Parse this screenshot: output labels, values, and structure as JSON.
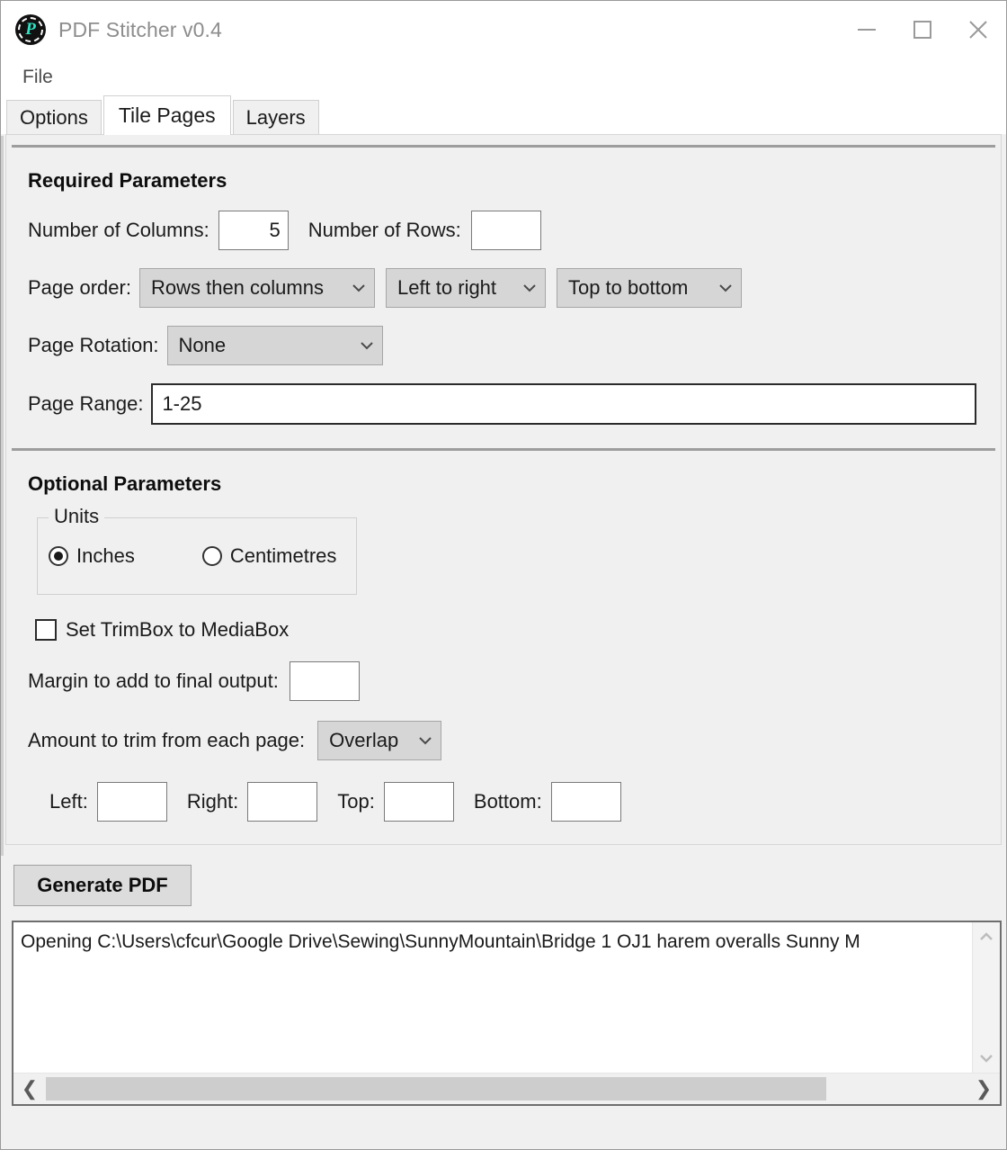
{
  "window": {
    "title": "PDF Stitcher v0.4",
    "icon": "pdf-stitcher-logo",
    "controls": {
      "minimize": "minimize-icon",
      "maximize": "maximize-icon",
      "close": "close-icon"
    }
  },
  "menubar": {
    "items": [
      {
        "label": "File"
      }
    ]
  },
  "tabs": [
    {
      "label": "Options",
      "selected": false
    },
    {
      "label": "Tile Pages",
      "selected": true
    },
    {
      "label": "Layers",
      "selected": false
    }
  ],
  "required": {
    "heading": "Required Parameters",
    "columns_label": "Number of Columns:",
    "columns_value": "5",
    "rows_label": "Number of Rows:",
    "rows_value": "",
    "page_order_label": "Page order:",
    "page_order_value": "Rows then columns",
    "horizontal_order_value": "Left to right",
    "vertical_order_value": "Top to bottom",
    "rotation_label": "Page Rotation:",
    "rotation_value": "None",
    "page_range_label": "Page Range:",
    "page_range_value": "1-25"
  },
  "optional": {
    "heading": "Optional Parameters",
    "units_group_label": "Units",
    "unit_inches": "Inches",
    "unit_centimetres": "Centimetres",
    "units_selected": "Inches",
    "trimbox_label": "Set TrimBox to MediaBox",
    "trimbox_checked": false,
    "margin_label": "Margin to add to final output:",
    "margin_value": "",
    "trim_label": "Amount to trim from each page:",
    "trim_mode_value": "Overlap",
    "left_label": "Left:",
    "left_value": "",
    "right_label": "Right:",
    "right_value": "",
    "top_label": "Top:",
    "top_value": "",
    "bottom_label": "Bottom:",
    "bottom_value": ""
  },
  "actions": {
    "generate_label": "Generate PDF"
  },
  "log": {
    "text": "Opening C:\\Users\\cfcur\\Google Drive\\Sewing\\SunnyMountain\\Bridge 1 OJ1 harem overalls Sunny M",
    "scroll_up_icon": "chevron-up-icon",
    "scroll_down_icon": "chevron-down-icon",
    "scroll_left_icon": "❮",
    "scroll_right_icon": "❯"
  }
}
